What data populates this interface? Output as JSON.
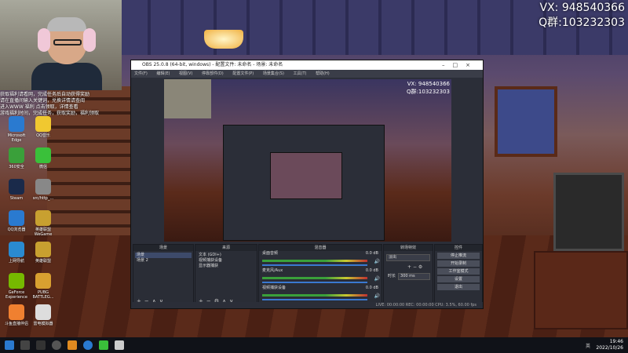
{
  "watermark": {
    "line1": "VX:  948540366",
    "line2": "Q群:103232303"
  },
  "overlay_text": [
    "获取福利请看网，完成任务后自动获得奖励",
    "请在直播间输入关键词，兑换详情请查阅",
    "进入WWW 福利 点击领取，详情查看",
    "游戏福利时间，完成任务，获取奖励，福利领取"
  ],
  "desktop_icons": [
    {
      "label": "Microsoft Edge",
      "color": "#2a7ad0"
    },
    {
      "label": "QQ音乐",
      "color": "#f0c830"
    },
    {
      "label": "360安全",
      "color": "#3aa03a"
    },
    {
      "label": "微信",
      "color": "#3ac03a"
    },
    {
      "label": "Steam",
      "color": "#1a2a4a"
    },
    {
      "label": "src/http_...",
      "color": "#888888"
    },
    {
      "label": "QQ浏览器",
      "color": "#2a7ad0"
    },
    {
      "label": "英雄联盟 WeGame",
      "color": "#c8a030"
    },
    {
      "label": "上网导航",
      "color": "#2a8ad0"
    },
    {
      "label": "英雄联盟",
      "color": "#c8a030"
    },
    {
      "label": "GeForce Experience",
      "color": "#76b900"
    },
    {
      "label": "PUBG BATTLEG...",
      "color": "#d8a030"
    },
    {
      "label": "斗鱼直播伴侣",
      "color": "#f08030"
    },
    {
      "label": "雷电模拟器",
      "color": "#dddddd"
    }
  ],
  "obs": {
    "title": "OBS 25.0.8 (64-bit, windows) - 配置文件: 未命名 - 场景: 未命名",
    "menu": [
      "文件(F)",
      "编辑(E)",
      "视图(V)",
      "停靠部件(D)",
      "配置文件(P)",
      "场景集合(S)",
      "工具(T)",
      "帮助(H)"
    ],
    "preview_text": {
      "line1": "VX:  948540366",
      "line2": "Q群:103232303"
    },
    "scenes": {
      "header": "场景",
      "items": [
        "场景",
        "场景 2"
      ]
    },
    "sources": {
      "header": "来源",
      "items": [
        "文本 (GDI+)",
        "视频捕获设备",
        "显示器捕获"
      ]
    },
    "mixer": {
      "header": "混音器",
      "channels": [
        {
          "name": "桌面音频",
          "db": "0.0 dB"
        },
        {
          "name": "麦克风/Aux",
          "db": "0.0 dB"
        },
        {
          "name": "视频捕获设备",
          "db": "0.0 dB"
        }
      ]
    },
    "transitions": {
      "header": "转场特效",
      "type": "淡出",
      "duration_label": "时长",
      "duration": "300 ms"
    },
    "controls": {
      "header": "控件",
      "buttons": [
        "停止推流",
        "开始录制",
        "工作室模式",
        "设置",
        "退出"
      ]
    },
    "status": "LIVE: 00:00:00   REC: 00:00:00   CPU: 3.5%, 60.00 fps"
  },
  "taskbar": {
    "time": "19:46",
    "date": "2022/10/26",
    "lang": "英"
  }
}
